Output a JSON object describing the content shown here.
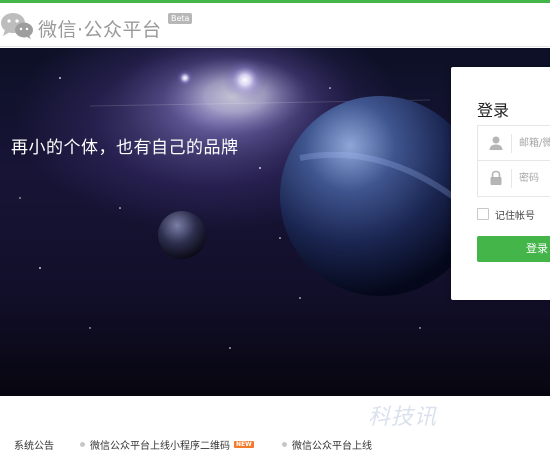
{
  "header": {
    "site_title": "微信·公众平台",
    "beta_label": "Beta",
    "logo_icon": "wechat-bubbles-icon"
  },
  "banner": {
    "slogan": "再小的个体，也有自己的品牌"
  },
  "login": {
    "title": "登录",
    "username_placeholder": "邮箱/微信号/QQ号",
    "password_placeholder": "密码",
    "remember_label": "记住帐号",
    "submit_label": "登录",
    "user_icon": "user-icon",
    "lock_icon": "lock-icon"
  },
  "notices": {
    "heading": "系统公告",
    "items": [
      {
        "text": "微信公众平台上线小程序二维码",
        "badge": "NEW"
      },
      {
        "text": "微信公众平台上线",
        "badge": ""
      }
    ]
  },
  "watermark": "科技讯",
  "colors": {
    "accent": "#44b549",
    "badge": "#f37b2b",
    "banner_dark": "#0d1026"
  }
}
